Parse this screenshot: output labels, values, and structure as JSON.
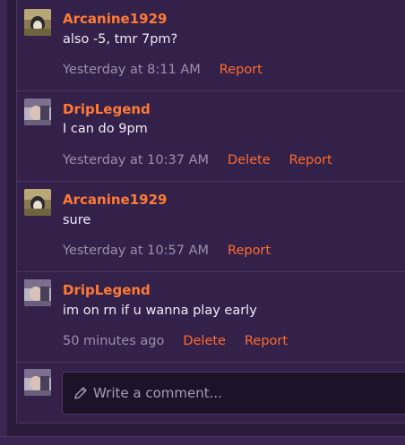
{
  "comments": [
    {
      "author": "Arcanine1929",
      "text": "also -5, tmr 7pm?",
      "time": "Yesterday at 8:11 AM",
      "actions": [
        "Report"
      ]
    },
    {
      "author": "DripLegend",
      "text": "I can do 9pm",
      "time": "Yesterday at 10:37 AM",
      "actions": [
        "Delete",
        "Report"
      ]
    },
    {
      "author": "Arcanine1929",
      "text": "sure",
      "time": "Yesterday at 10:57 AM",
      "actions": [
        "Report"
      ]
    },
    {
      "author": "DripLegend",
      "text": "im on rn if u wanna play early",
      "time": "50 minutes ago",
      "actions": [
        "Delete",
        "Report"
      ]
    }
  ],
  "composer": {
    "placeholder": "Write a comment..."
  },
  "colors": {
    "author": "#ff7a33",
    "action": "#ff6a2a",
    "background": "#33214a"
  },
  "icons": {
    "compose": "pencil-icon"
  }
}
